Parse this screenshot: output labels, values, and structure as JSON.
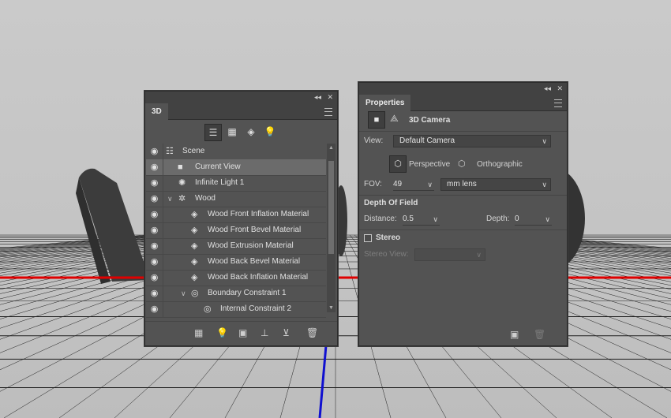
{
  "colors": {
    "panel_bg": "#535353",
    "bar_bg": "#424242",
    "selected_row": "#6b6b6b",
    "viewport_bg": "#c6c6c6",
    "axis_red": "#e00000",
    "axis_blue": "#1010d0"
  },
  "panel_3d": {
    "tab": "3D",
    "filter_icons": [
      "scene-filter-icon",
      "mesh-filter-icon",
      "material-filter-icon",
      "light-filter-icon"
    ],
    "rows": [
      {
        "label": "Scene",
        "icon": "scene-icon"
      },
      {
        "label": "Current View",
        "icon": "camera-icon"
      },
      {
        "label": "Infinite Light 1",
        "icon": "light-icon"
      },
      {
        "label": "Wood",
        "icon": "mesh-icon"
      },
      {
        "label": "Wood Front Inflation Material",
        "icon": "material-icon"
      },
      {
        "label": "Wood Front Bevel Material",
        "icon": "material-icon"
      },
      {
        "label": "Wood Extrusion Material",
        "icon": "material-icon"
      },
      {
        "label": "Wood Back Bevel Material",
        "icon": "material-icon"
      },
      {
        "label": "Wood Back Inflation Material",
        "icon": "material-icon"
      },
      {
        "label": "Boundary Constraint 1",
        "icon": "constraint-icon"
      },
      {
        "label": "Internal Constraint 2",
        "icon": "constraint-icon"
      }
    ],
    "footer_icons": [
      "add-mesh-icon",
      "add-light-icon",
      "render-icon",
      "ground-plane-icon",
      "delete-icon"
    ]
  },
  "properties": {
    "tab": "Properties",
    "title": "3D Camera",
    "view_label": "View:",
    "view_value": "Default Camera",
    "perspective_label": "Perspective",
    "orthographic_label": "Orthographic",
    "fov_label": "FOV:",
    "fov_value": "49",
    "fov_unit": "mm lens",
    "dof_section": "Depth Of Field",
    "distance_label": "Distance:",
    "distance_value": "0.5",
    "depth_label": "Depth:",
    "depth_value": "0",
    "stereo_label": "Stereo",
    "stereo_view_label": "Stereo View:"
  }
}
